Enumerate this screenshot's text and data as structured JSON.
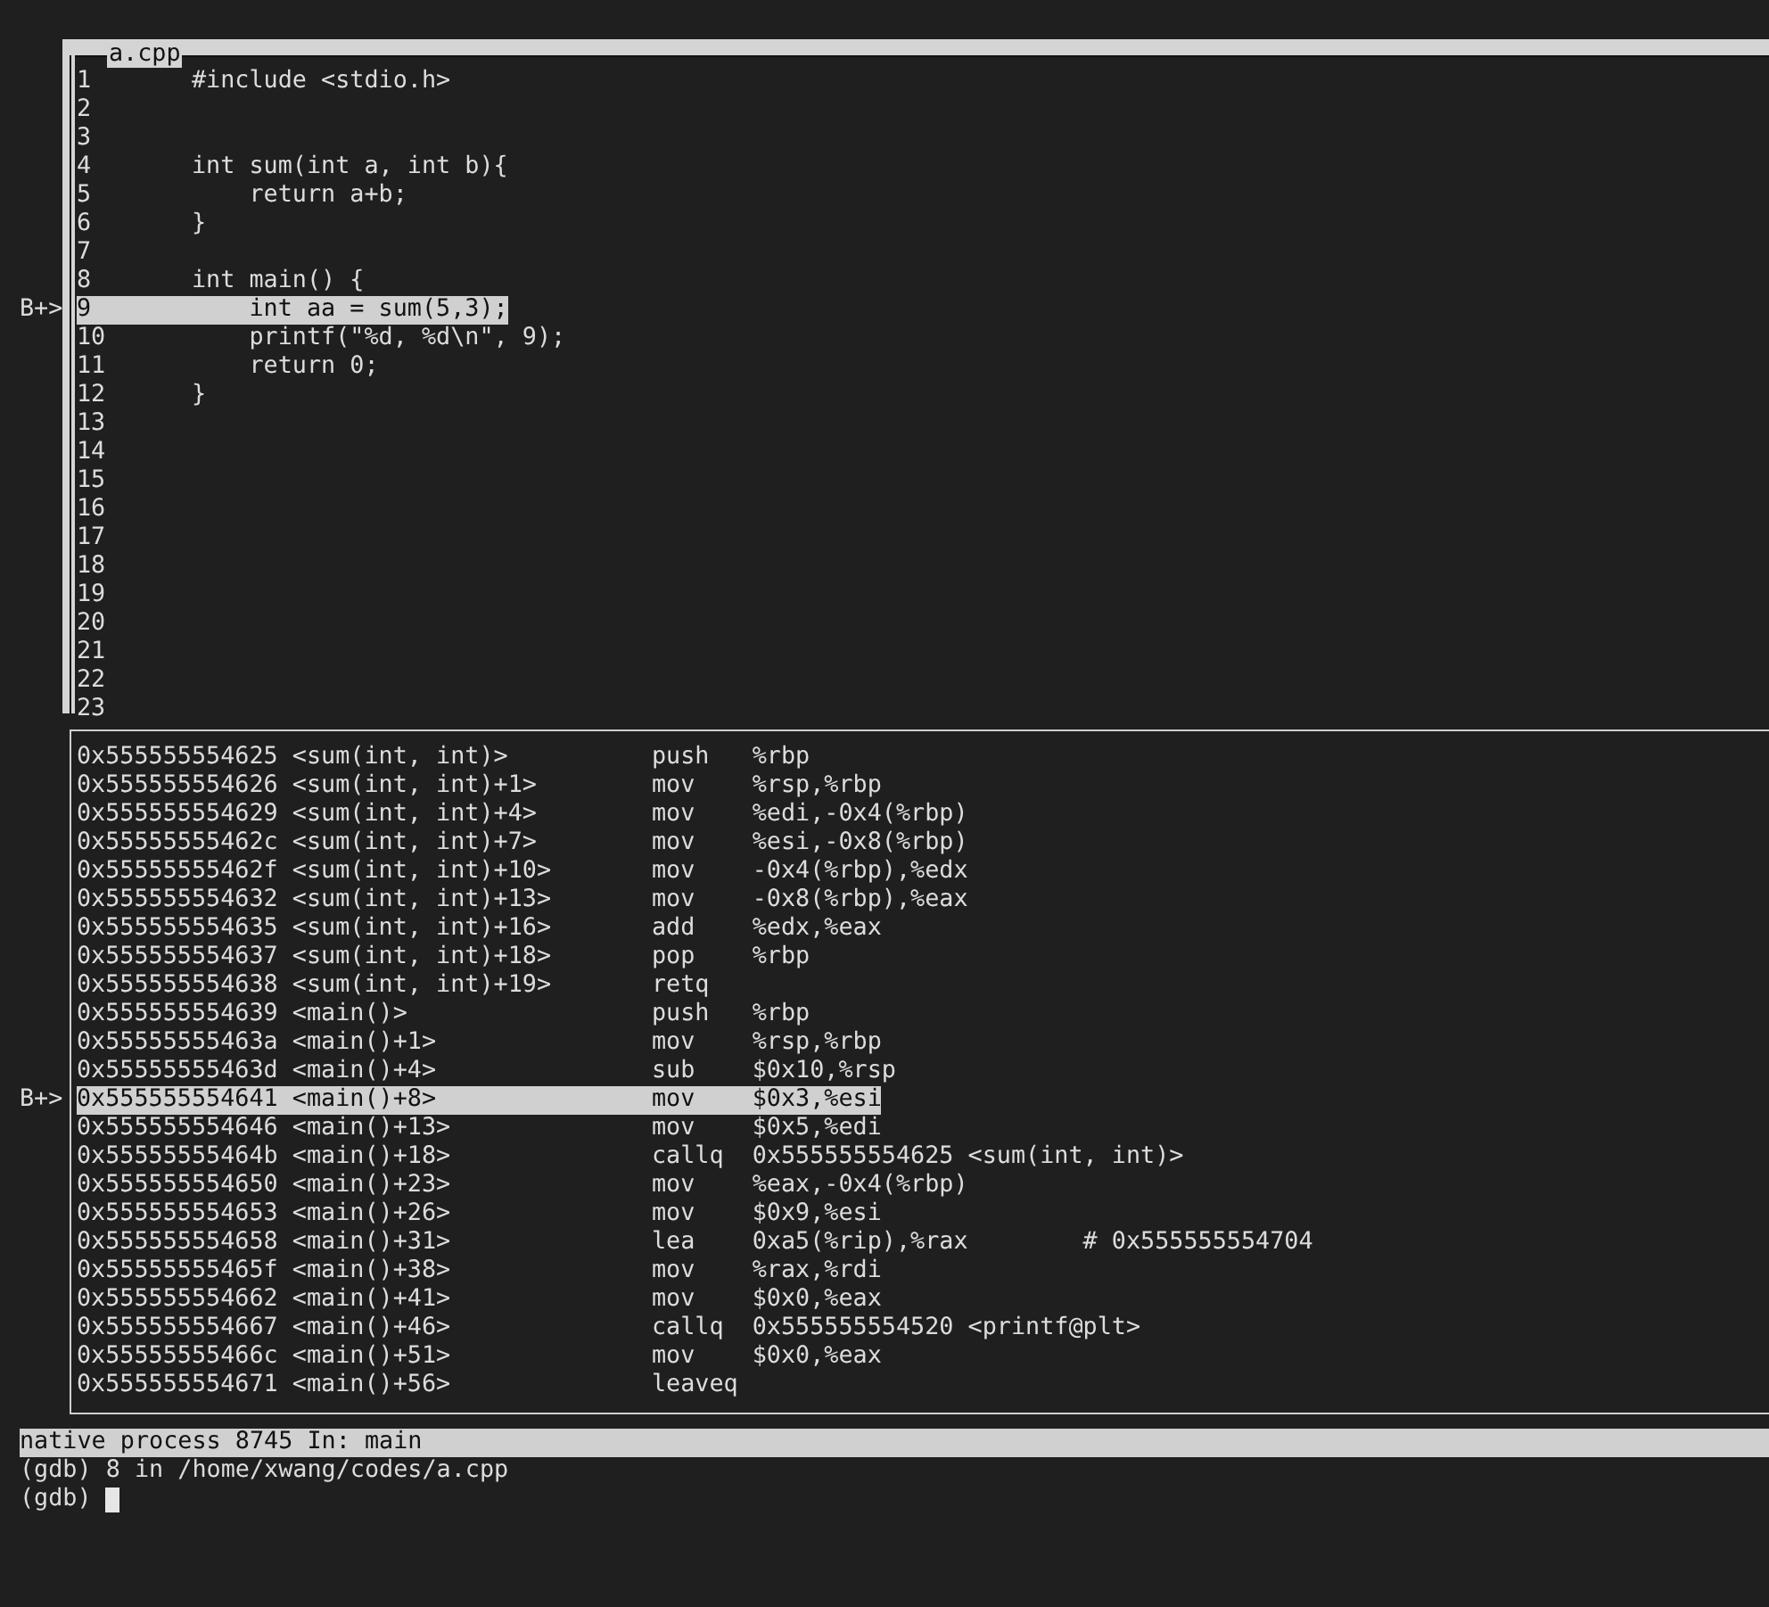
{
  "source": {
    "title": "a.cpp",
    "lines": [
      {
        "number": "1",
        "code": "#include <stdio.h>",
        "selected": false
      },
      {
        "number": "2",
        "selected": false
      },
      {
        "number": "3",
        "selected": false
      },
      {
        "number": "4",
        "code": "int sum(int a, int b){",
        "selected": false
      },
      {
        "number": "5",
        "code": "    return a+b;",
        "selected": false
      },
      {
        "number": "6",
        "code": "}",
        "selected": false
      },
      {
        "number": "7",
        "selected": false
      },
      {
        "number": "8",
        "code": "int main() {",
        "selected": false
      },
      {
        "number": "9",
        "code": "    int aa = sum(5,3);",
        "marker": "B+>",
        "selected": true
      },
      {
        "number": "10",
        "code": "    printf(\"%d, %d\\n\", 9);",
        "selected": false
      },
      {
        "number": "11",
        "code": "    return 0;",
        "selected": false
      },
      {
        "number": "12",
        "code": "}",
        "selected": false
      },
      {
        "number": "13",
        "selected": false
      },
      {
        "number": "14",
        "selected": false
      },
      {
        "number": "15",
        "selected": false
      },
      {
        "number": "16",
        "selected": false
      },
      {
        "number": "17",
        "selected": false
      },
      {
        "number": "18",
        "selected": false
      },
      {
        "number": "19",
        "selected": false
      },
      {
        "number": "20",
        "selected": false
      },
      {
        "number": "21",
        "selected": false
      },
      {
        "number": "22",
        "selected": false
      },
      {
        "number": "23",
        "selected": false
      }
    ]
  },
  "disassembly": {
    "rows": [
      {
        "address": "0x555555554625",
        "symbol": "<sum(int, int)>",
        "mnemonic": "push",
        "operands": "%rbp",
        "selected": false
      },
      {
        "address": "0x555555554626",
        "symbol": "<sum(int, int)+1>",
        "mnemonic": "mov",
        "operands": "%rsp,%rbp",
        "selected": false
      },
      {
        "address": "0x555555554629",
        "symbol": "<sum(int, int)+4>",
        "mnemonic": "mov",
        "operands": "%edi,-0x4(%rbp)",
        "selected": false
      },
      {
        "address": "0x55555555462c",
        "symbol": "<sum(int, int)+7>",
        "mnemonic": "mov",
        "operands": "%esi,-0x8(%rbp)",
        "selected": false
      },
      {
        "address": "0x55555555462f",
        "symbol": "<sum(int, int)+10>",
        "mnemonic": "mov",
        "operands": "-0x4(%rbp),%edx",
        "selected": false
      },
      {
        "address": "0x555555554632",
        "symbol": "<sum(int, int)+13>",
        "mnemonic": "mov",
        "operands": "-0x8(%rbp),%eax",
        "selected": false
      },
      {
        "address": "0x555555554635",
        "symbol": "<sum(int, int)+16>",
        "mnemonic": "add",
        "operands": "%edx,%eax",
        "selected": false
      },
      {
        "address": "0x555555554637",
        "symbol": "<sum(int, int)+18>",
        "mnemonic": "pop",
        "operands": "%rbp",
        "selected": false
      },
      {
        "address": "0x555555554638",
        "symbol": "<sum(int, int)+19>",
        "mnemonic": "retq",
        "selected": false
      },
      {
        "address": "0x555555554639",
        "symbol": "<main()>",
        "mnemonic": "push",
        "operands": "%rbp",
        "selected": false
      },
      {
        "address": "0x55555555463a",
        "symbol": "<main()+1>",
        "mnemonic": "mov",
        "operands": "%rsp,%rbp",
        "selected": false
      },
      {
        "address": "0x55555555463d",
        "symbol": "<main()+4>",
        "mnemonic": "sub",
        "operands": "$0x10,%rsp",
        "selected": false
      },
      {
        "address": "0x555555554641",
        "symbol": "<main()+8>",
        "mnemonic": "mov",
        "operands": "$0x3,%esi",
        "marker": "B+>",
        "selected": true
      },
      {
        "address": "0x555555554646",
        "symbol": "<main()+13>",
        "mnemonic": "mov",
        "operands": "$0x5,%edi",
        "selected": false
      },
      {
        "address": "0x55555555464b",
        "symbol": "<main()+18>",
        "mnemonic": "callq",
        "operands": "0x555555554625 <sum(int, int)>",
        "selected": false
      },
      {
        "address": "0x555555554650",
        "symbol": "<main()+23>",
        "mnemonic": "mov",
        "operands": "%eax,-0x4(%rbp)",
        "selected": false
      },
      {
        "address": "0x555555554653",
        "symbol": "<main()+26>",
        "mnemonic": "mov",
        "operands": "$0x9,%esi",
        "selected": false
      },
      {
        "address": "0x555555554658",
        "symbol": "<main()+31>",
        "mnemonic": "lea",
        "operands": "0xa5(%rip),%rax",
        "comment": "# 0x555555554704",
        "selected": false
      },
      {
        "address": "0x55555555465f",
        "symbol": "<main()+38>",
        "mnemonic": "mov",
        "operands": "%rax,%rdi",
        "selected": false
      },
      {
        "address": "0x555555554662",
        "symbol": "<main()+41>",
        "mnemonic": "mov",
        "operands": "$0x0,%eax",
        "selected": false
      },
      {
        "address": "0x555555554667",
        "symbol": "<main()+46>",
        "mnemonic": "callq",
        "operands": "0x555555554520 <printf@plt>",
        "selected": false
      },
      {
        "address": "0x55555555466c",
        "symbol": "<main()+51>",
        "mnemonic": "mov",
        "operands": "$0x0,%eax",
        "selected": false
      },
      {
        "address": "0x555555554671",
        "symbol": "<main()+56>",
        "mnemonic": "leaveq",
        "selected": false
      }
    ]
  },
  "status_bar": {
    "text": "native process 8745 In: main"
  },
  "console": {
    "lines": [
      "(gdb) 8 in /home/xwang/codes/a.cpp"
    ],
    "prompt": "(gdb)"
  }
}
